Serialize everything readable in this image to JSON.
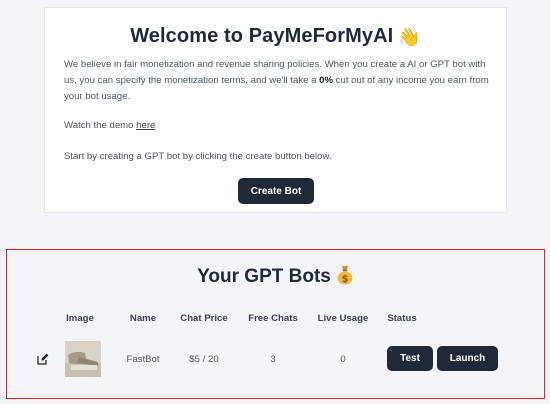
{
  "welcome": {
    "title": "Welcome to PayMeForMyAI",
    "title_emoji": "waving-hand-icon",
    "intro_before_bold": "We believe in fair monetization and revenue sharing policies. When you create a AI or GPT bot with us, you can specify the monetization terms, and we'll take a ",
    "intro_bold": "0%",
    "intro_after_bold": " cut out of any income you earn from your bot usage.",
    "demo_text": "Watch the demo ",
    "demo_link": "here",
    "start_text": "Start by creating a GPT bot by clicking the create button below.",
    "create_button": "Create Bot"
  },
  "bots": {
    "title": "Your GPT Bots",
    "title_emoji": "money-bag-icon",
    "columns": {
      "image": "Image",
      "name": "Name",
      "chat_price": "Chat Price",
      "free_chats": "Free Chats",
      "live_usage": "Live Usage",
      "status": "Status"
    },
    "rows": [
      {
        "name": "FastBot",
        "chat_price": "$5 / 20",
        "free_chats": "3",
        "live_usage": "0",
        "test_button": "Test",
        "launch_button": "Launch"
      }
    ]
  },
  "colors": {
    "button_bg": "#1f2937",
    "highlight_border": "#e02424",
    "page_bg": "#f3f5f9"
  }
}
